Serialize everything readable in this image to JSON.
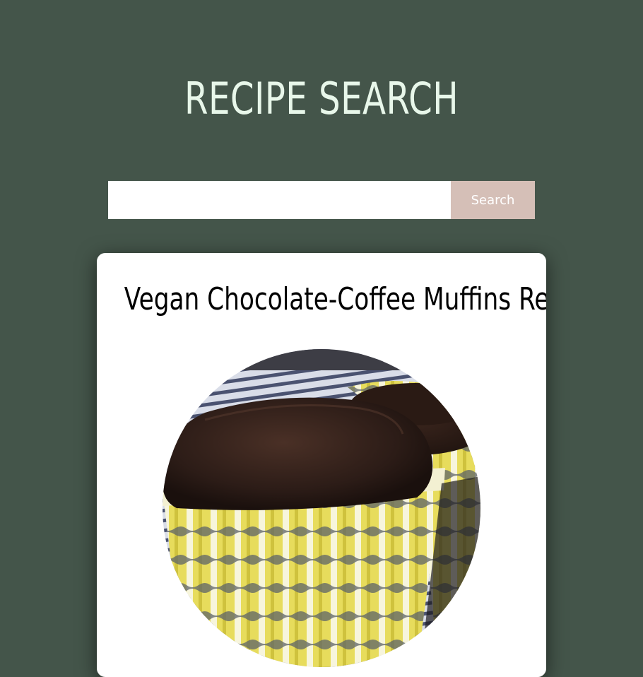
{
  "header": {
    "title": "RECIPE SEARCH"
  },
  "search": {
    "value": "",
    "placeholder": "",
    "button_label": "Search"
  },
  "results": [
    {
      "title": "Vegan Chocolate-Coffee Muffins Recipe",
      "image_alt": "chocolate muffin in yellow striped paper liner"
    }
  ],
  "colors": {
    "background": "#44554a",
    "title_text": "#e8f7ea",
    "search_button": "#d5bfb7",
    "card_background": "#ffffff"
  }
}
